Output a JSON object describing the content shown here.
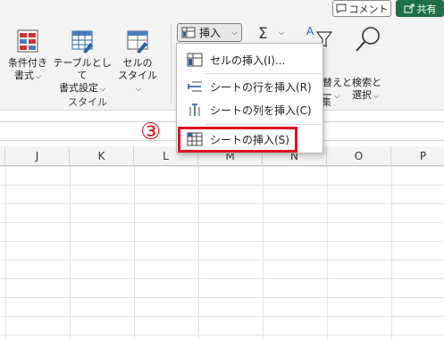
{
  "topbar": {
    "comment_label": "コメント",
    "share_label": "共有"
  },
  "ribbon": {
    "conditional": {
      "line1": "条件付き",
      "line2": "書式"
    },
    "table": {
      "line1": "テーブルとして",
      "line2": "書式設定"
    },
    "cellstyle": {
      "line1": "セルの",
      "line2": "スタイル"
    },
    "styles_group": "スタイル",
    "insert_label": "挿入",
    "sigma": "Σ",
    "sort_partial": {
      "line1": "替えと",
      "line2": "ー"
    },
    "find": {
      "line1": "検索と",
      "line2": "選択"
    },
    "editing_group_partial": "集"
  },
  "menu": {
    "items": [
      {
        "label": "セルの挿入(I)...",
        "icon": "insert-cells-icon"
      },
      {
        "label": "シートの行を挿入(R)",
        "icon": "insert-rows-icon"
      },
      {
        "label": "シートの列を挿入(C)",
        "icon": "insert-columns-icon"
      },
      {
        "label": "シートの挿入(S)",
        "icon": "insert-sheet-icon"
      }
    ]
  },
  "annotation": {
    "step": "③",
    "color": "#e0101f"
  },
  "columns": [
    "J",
    "K",
    "L",
    "M",
    "N",
    "O",
    "P"
  ]
}
